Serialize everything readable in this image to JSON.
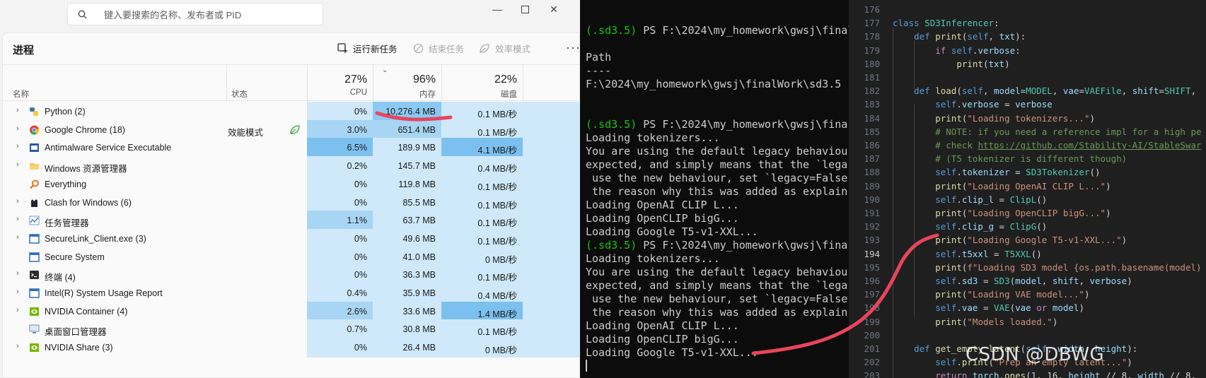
{
  "task_manager": {
    "search_placeholder": "键入要搜索的名称、发布者或 PID",
    "title": "进程",
    "commands": {
      "run_new_task": "运行新任务",
      "end_task": "结束任务",
      "efficiency_mode": "效率模式"
    },
    "columns": {
      "name": "名称",
      "status": "状态",
      "cpu_pct": "27%",
      "cpu": "CPU",
      "mem_pct": "96%",
      "mem": "内存",
      "disk_pct": "22%",
      "disk": "磁盘"
    },
    "processes": [
      {
        "name": "Python (2)",
        "status": "",
        "cpu": "0%",
        "mem": "10,276.4 MB",
        "disk": "0.1 MB/秒"
      },
      {
        "name": "Google Chrome (18)",
        "status": "效能模式",
        "cpu": "3.0%",
        "mem": "651.4 MB",
        "disk": "0.1 MB/秒"
      },
      {
        "name": "Antimalware Service Executable",
        "status": "",
        "cpu": "6.5%",
        "mem": "189.9 MB",
        "disk": "4.1 MB/秒"
      },
      {
        "name": "Windows 资源管理器",
        "status": "",
        "cpu": "0.2%",
        "mem": "145.7 MB",
        "disk": "0.4 MB/秒"
      },
      {
        "name": "Everything",
        "status": "",
        "cpu": "0%",
        "mem": "119.8 MB",
        "disk": "0.1 MB/秒"
      },
      {
        "name": "Clash for Windows (6)",
        "status": "",
        "cpu": "0%",
        "mem": "85.5 MB",
        "disk": "0.1 MB/秒"
      },
      {
        "name": "任务管理器",
        "status": "",
        "cpu": "1.1%",
        "mem": "63.7 MB",
        "disk": "0.1 MB/秒"
      },
      {
        "name": "SecureLink_Client.exe (3)",
        "status": "",
        "cpu": "0%",
        "mem": "49.6 MB",
        "disk": "0.1 MB/秒"
      },
      {
        "name": "Secure System",
        "status": "",
        "cpu": "0%",
        "mem": "41.0 MB",
        "disk": "0 MB/秒"
      },
      {
        "name": "终端 (4)",
        "status": "",
        "cpu": "0%",
        "mem": "36.3 MB",
        "disk": "0.1 MB/秒"
      },
      {
        "name": "Intel(R) System Usage Report",
        "status": "",
        "cpu": "0.4%",
        "mem": "35.9 MB",
        "disk": "0.4 MB/秒"
      },
      {
        "name": "NVIDIA Container (4)",
        "status": "",
        "cpu": "2.6%",
        "mem": "33.6 MB",
        "disk": "1.4 MB/秒"
      },
      {
        "name": "桌面窗口管理器",
        "status": "",
        "cpu": "0.7%",
        "mem": "30.8 MB",
        "disk": "0.1 MB/秒"
      },
      {
        "name": "NVIDIA Share (3)",
        "status": "",
        "cpu": "0%",
        "mem": "26.4 MB",
        "disk": "0 MB/秒"
      }
    ]
  },
  "terminal": {
    "lines": [
      {
        "prefix": "(.sd3.5)",
        "text": " PS F:\\2024\\my_homework\\gwsj\\final"
      },
      {
        "prefix": "",
        "text": ""
      },
      {
        "prefix": "",
        "text": "Path"
      },
      {
        "prefix": "",
        "text": "----"
      },
      {
        "prefix": "",
        "text": "F:\\2024\\my_homework\\gwsj\\finalWork\\sd3.5"
      },
      {
        "prefix": "",
        "text": ""
      },
      {
        "prefix": "",
        "text": ""
      },
      {
        "prefix": "(.sd3.5)",
        "text": " PS F:\\2024\\my_homework\\gwsj\\fina"
      },
      {
        "prefix": "",
        "text": "Loading tokenizers..."
      },
      {
        "prefix": "",
        "text": "You are using the default legacy behaviou"
      },
      {
        "prefix": "",
        "text": "expected, and simply means that the `lega"
      },
      {
        "prefix": "",
        "text": " use the new behaviour, set `legacy=False"
      },
      {
        "prefix": "",
        "text": " the reason why this was added as explain"
      },
      {
        "prefix": "",
        "text": "Loading OpenAI CLIP L..."
      },
      {
        "prefix": "",
        "text": "Loading OpenCLIP bigG..."
      },
      {
        "prefix": "",
        "text": "Loading Google T5-v1-XXL..."
      },
      {
        "prefix": "(.sd3.5)",
        "text": " PS F:\\2024\\my_homework\\gwsj\\fina"
      },
      {
        "prefix": "",
        "text": "Loading tokenizers..."
      },
      {
        "prefix": "",
        "text": "You are using the default legacy behaviou"
      },
      {
        "prefix": "",
        "text": "expected, and simply means that the `lega"
      },
      {
        "prefix": "",
        "text": " use the new behaviour, set `legacy=False"
      },
      {
        "prefix": "",
        "text": " the reason why this was added as explain"
      },
      {
        "prefix": "",
        "text": "Loading OpenAI CLIP L..."
      },
      {
        "prefix": "",
        "text": "Loading OpenCLIP bigG..."
      },
      {
        "prefix": "",
        "text": "Loading Google T5-v1-XXL..."
      }
    ]
  },
  "editor": {
    "active_line": "194",
    "lines": [
      {
        "n": "176",
        "code": ""
      },
      {
        "n": "177",
        "code": "class SD3Inferencer:"
      },
      {
        "n": "178",
        "code": "    def print(self, txt):"
      },
      {
        "n": "179",
        "code": "        if self.verbose:"
      },
      {
        "n": "180",
        "code": "            print(txt)"
      },
      {
        "n": "181",
        "code": ""
      },
      {
        "n": "182",
        "code": "    def load(self, model=MODEL, vae=VAEFile, shift=SHIFT,"
      },
      {
        "n": "183",
        "code": "        self.verbose = verbose"
      },
      {
        "n": "184",
        "code": "        print(\"Loading tokenizers...\")"
      },
      {
        "n": "185",
        "code": "        # NOTE: if you need a reference impl for a high pe"
      },
      {
        "n": "186",
        "code": "        # check https://github.com/Stability-AI/StableSwar"
      },
      {
        "n": "187",
        "code": "        # (T5 tokenizer is different though)"
      },
      {
        "n": "188",
        "code": "        self.tokenizer = SD3Tokenizer()"
      },
      {
        "n": "189",
        "code": "        print(\"Loading OpenAI CLIP L...\")"
      },
      {
        "n": "190",
        "code": "        self.clip_l = ClipL()"
      },
      {
        "n": "191",
        "code": "        print(\"Loading OpenCLIP bigG...\")"
      },
      {
        "n": "192",
        "code": "        self.clip_g = ClipG()"
      },
      {
        "n": "193",
        "code": "        print(\"Loading Google T5-v1-XXL...\")"
      },
      {
        "n": "194",
        "code": "        self.t5xxl = T5XXL()"
      },
      {
        "n": "195",
        "code": "        print(f\"Loading SD3 model {os.path.basename(model)"
      },
      {
        "n": "196",
        "code": "        self.sd3 = SD3(model, shift, verbose)"
      },
      {
        "n": "197",
        "code": "        print(\"Loading VAE model...\")"
      },
      {
        "n": "198",
        "code": "        self.vae = VAE(vae or model)"
      },
      {
        "n": "199",
        "code": "        print(\"Models loaded.\")"
      },
      {
        "n": "200",
        "code": ""
      },
      {
        "n": "201",
        "code": "    def get_empty_latent(self, width, height):"
      },
      {
        "n": "202",
        "code": "        self.print(\"Prep an empty latent...\")"
      },
      {
        "n": "203",
        "code": "        return torch.ones(1, 16, height // 8, width // 8,"
      }
    ]
  },
  "watermark": "CSDN @DBWG",
  "colors": {
    "heat_light": "#cfe9fb",
    "heat_mid": "#a9d5f5",
    "heat_strong": "#7cc0ef",
    "terminal_prompt": "#16c60c",
    "annotation": "#e8455a"
  }
}
